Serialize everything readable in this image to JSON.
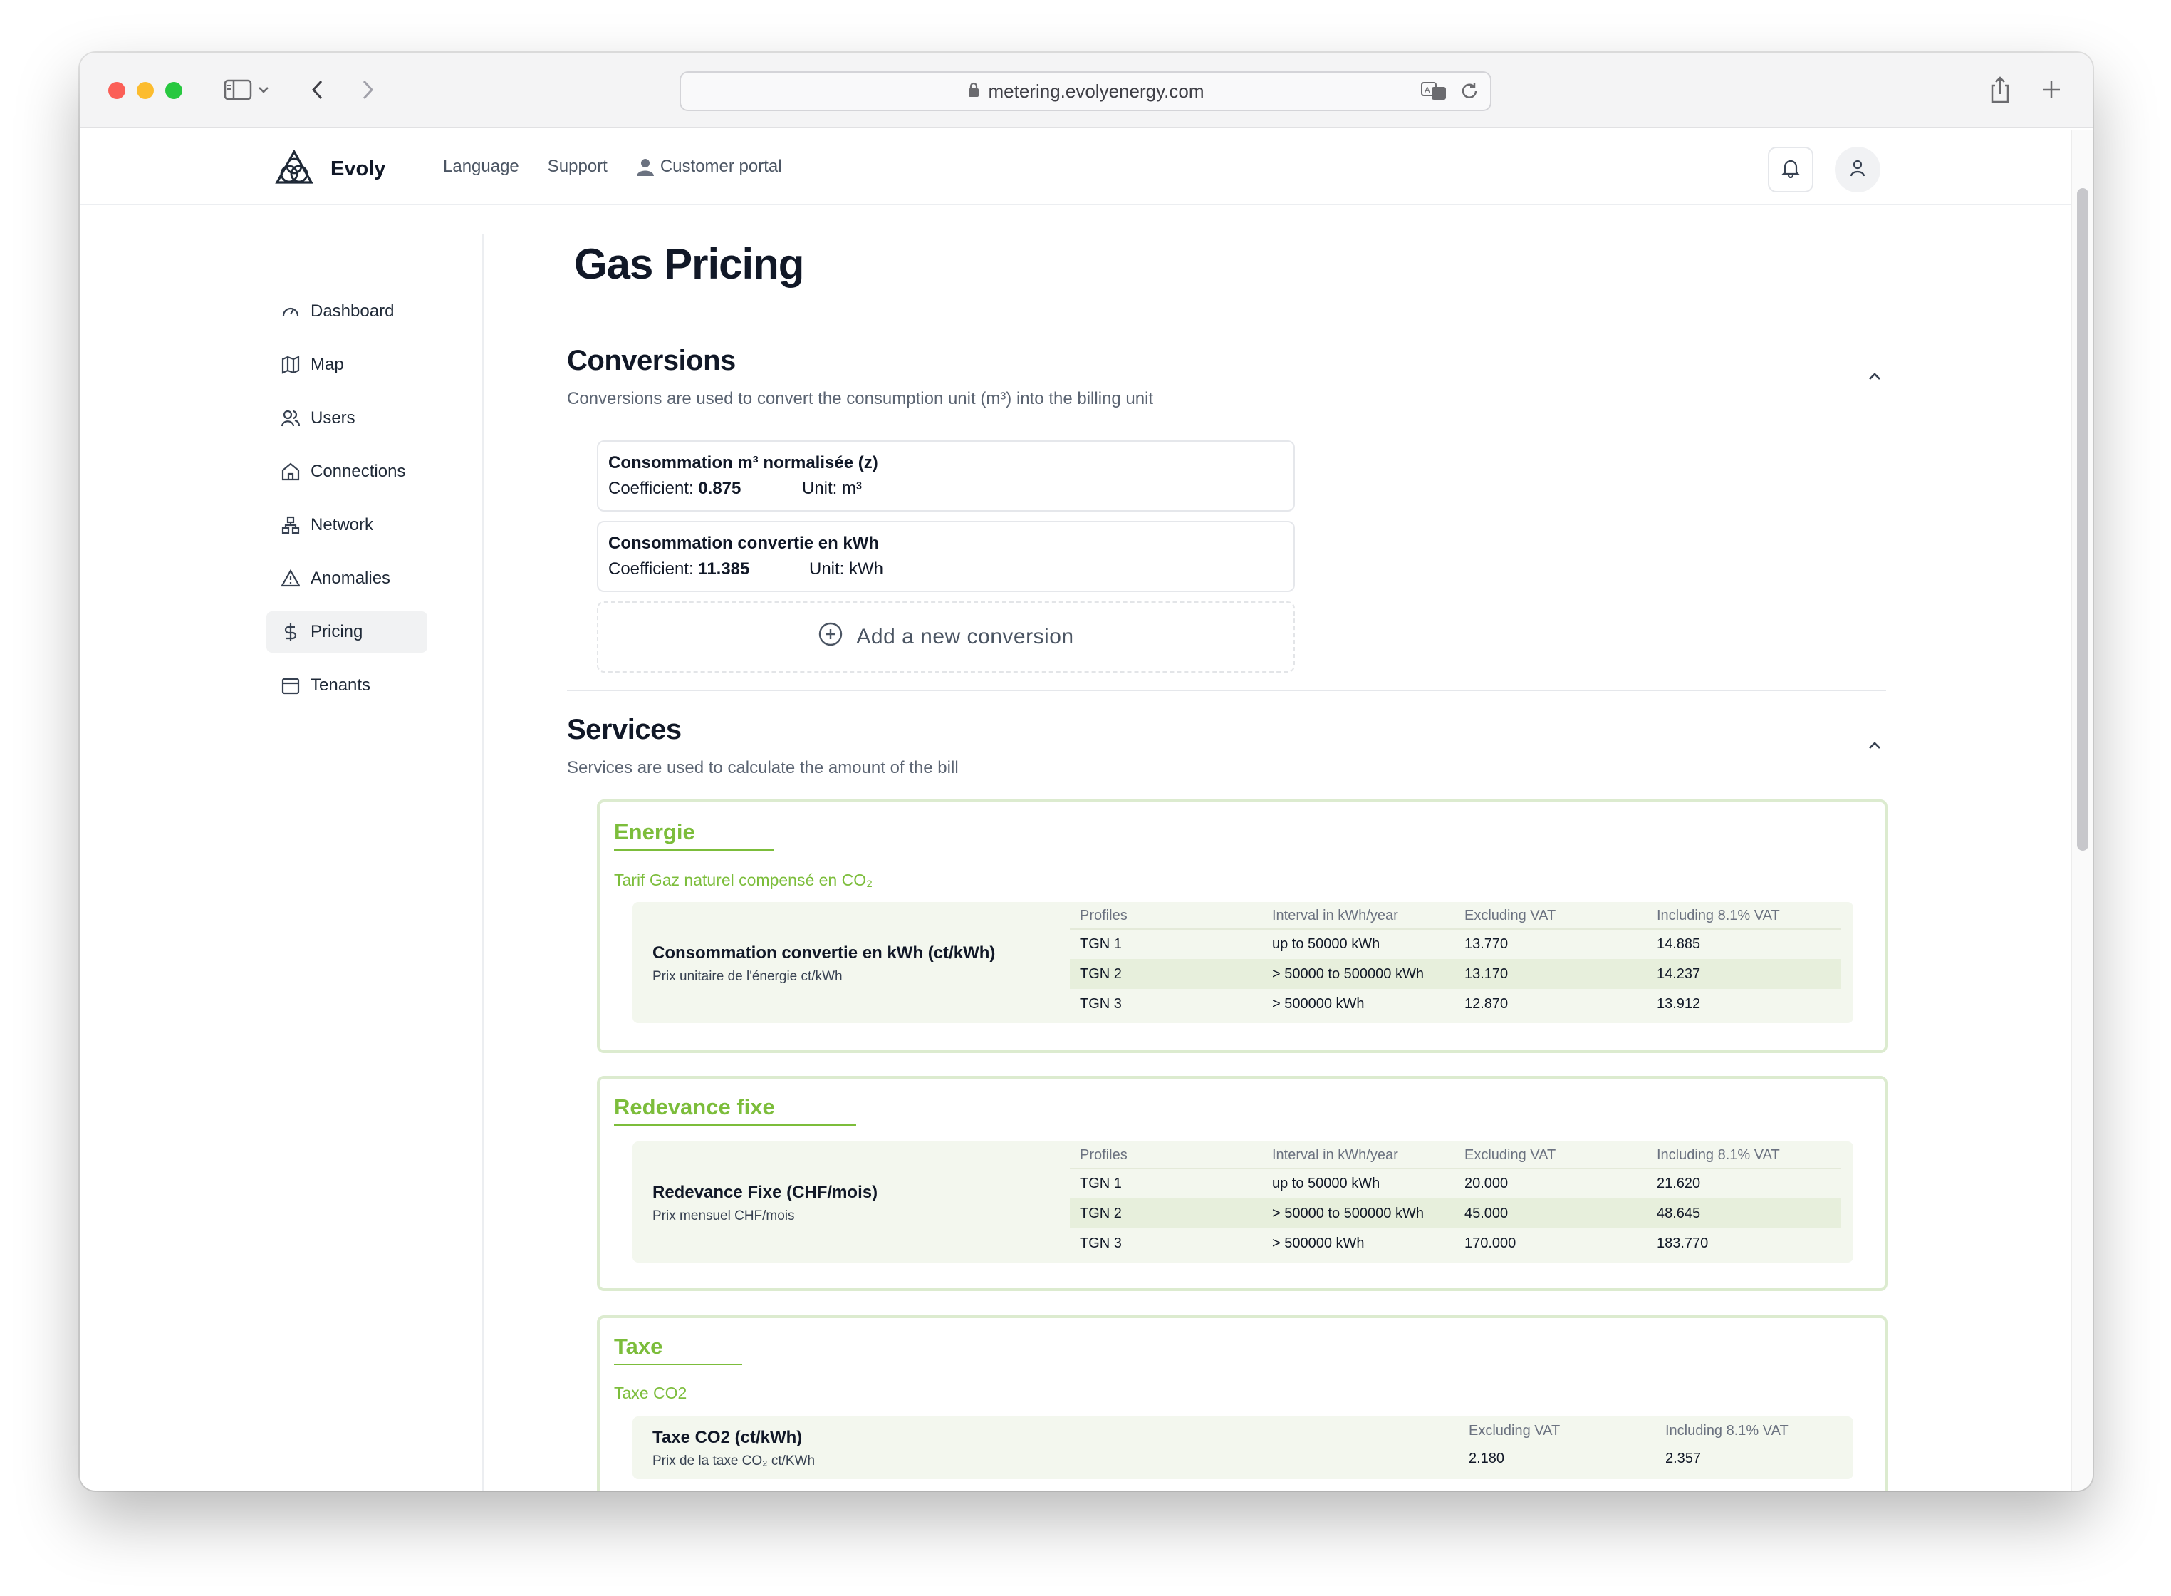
{
  "browser": {
    "url": "metering.evolyenergy.com"
  },
  "header": {
    "brand": "Evoly",
    "nav": [
      "Language",
      "Support",
      "Customer portal"
    ]
  },
  "sidebar": {
    "items": [
      {
        "label": "Dashboard",
        "icon": "gauge-icon"
      },
      {
        "label": "Map",
        "icon": "map-icon"
      },
      {
        "label": "Users",
        "icon": "users-icon"
      },
      {
        "label": "Connections",
        "icon": "home-icon"
      },
      {
        "label": "Network",
        "icon": "network-icon"
      },
      {
        "label": "Anomalies",
        "icon": "warning-icon"
      },
      {
        "label": "Pricing",
        "icon": "dollar-icon",
        "active": true
      },
      {
        "label": "Tenants",
        "icon": "calendar-icon"
      }
    ]
  },
  "page": {
    "title": "Gas Pricing"
  },
  "conversions": {
    "title": "Conversions",
    "description": "Conversions are used to convert the consumption unit (m³) into the billing unit",
    "coef_label": "Coefficient:",
    "unit_label": "Unit:",
    "items": [
      {
        "name": "Consommation m³ normalisée (z)",
        "coefficient": "0.875",
        "unit": "m³"
      },
      {
        "name": "Consommation convertie en kWh",
        "coefficient": "11.385",
        "unit": "kWh"
      }
    ],
    "add_label": "Add a new conversion"
  },
  "services": {
    "title": "Services",
    "description": "Services are used to calculate the amount of the bill",
    "columns": [
      "Profiles",
      "Interval in kWh/year",
      "Excluding VAT",
      "Including 8.1% VAT"
    ],
    "cards": [
      {
        "title": "Energie",
        "subtitle": "Tarif Gaz naturel compensé en CO₂",
        "item_title": "Consommation convertie en kWh (ct/kWh)",
        "item_desc": "Prix unitaire de l'énergie ct/kWh",
        "rows": [
          [
            "TGN 1",
            "up to 50000 kWh",
            "13.770",
            "14.885"
          ],
          [
            "TGN 2",
            "> 50000 to 500000 kWh",
            "13.170",
            "14.237"
          ],
          [
            "TGN 3",
            "> 500000 kWh",
            "12.870",
            "13.912"
          ]
        ]
      },
      {
        "title": "Redevance fixe",
        "subtitle": "",
        "item_title": "Redevance Fixe (CHF/mois)",
        "item_desc": "Prix mensuel CHF/mois",
        "rows": [
          [
            "TGN 1",
            "up to 50000 kWh",
            "20.000",
            "21.620"
          ],
          [
            "TGN 2",
            "> 50000 to 500000 kWh",
            "45.000",
            "48.645"
          ],
          [
            "TGN 3",
            "> 500000 kWh",
            "170.000",
            "183.770"
          ]
        ]
      },
      {
        "title": "Taxe",
        "subtitle": "Taxe CO2",
        "item_title": "Taxe CO2 (ct/kWh)",
        "item_desc": "Prix de la taxe CO₂ ct/KWh",
        "columns": [
          "Excluding VAT",
          "Including 8.1% VAT"
        ],
        "rows": [
          [
            "2.180",
            "2.357"
          ]
        ]
      }
    ]
  },
  "colors": {
    "accent_green": "#7cbd3b",
    "card_border": "#dcebcf",
    "panel_bg": "#f3f7ee"
  }
}
